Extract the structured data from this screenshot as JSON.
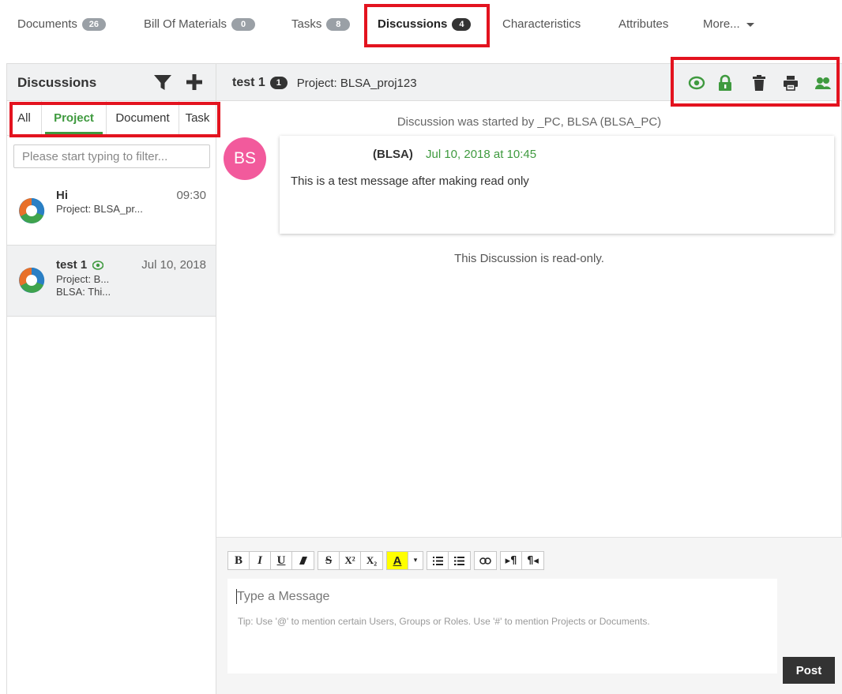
{
  "tabs": [
    {
      "label": "Documents",
      "count": "26"
    },
    {
      "label": "Bill Of Materials",
      "count": "0"
    },
    {
      "label": "Tasks",
      "count": "8"
    },
    {
      "label": "Discussions",
      "count": "4"
    },
    {
      "label": "Characteristics"
    },
    {
      "label": "Attributes"
    },
    {
      "label": "More..."
    }
  ],
  "active_tab": "Discussions",
  "sidebar": {
    "title": "Discussions",
    "filter_tabs": [
      "All",
      "Project",
      "Document",
      "Task"
    ],
    "active_filter": "Project",
    "filter_placeholder": "Please start typing to filter...",
    "items": [
      {
        "title": "Hi",
        "time": "09:30",
        "line1": "Project: BLSA_pr...",
        "line2": ""
      },
      {
        "title": "test 1",
        "time": "Jul 10, 2018",
        "line1": "Project: B...",
        "line2": "BLSA: Thi...",
        "watched": true,
        "selected": true
      }
    ]
  },
  "discussion": {
    "title": "test 1",
    "count": "1",
    "project": "Project: BLSA_proj123",
    "header_icons": [
      "eye-icon",
      "lock-icon",
      "trash-icon",
      "print-icon",
      "participants-icon"
    ],
    "started_text": "Discussion was started by _PC, BLSA (BLSA_PC)",
    "message": {
      "avatar": "BS",
      "author": "(BLSA)",
      "date": "Jul 10, 2018 at 10:45",
      "body": "This is a test message after making read only"
    },
    "readonly_text": "This Discussion is read-only."
  },
  "composer": {
    "toolbar": [
      "B",
      "I",
      "U",
      "eraser",
      "S",
      "X²",
      "X₂",
      "A",
      "▾",
      "bullet-list",
      "numbered-list",
      "link",
      "ltr",
      "rtl"
    ],
    "placeholder": "Type a Message",
    "tip": "Tip: Use '@' to mention certain Users, Groups or Roles. Use '#' to mention Projects or Documents.",
    "post_label": "Post"
  },
  "colors": {
    "accent_green": "#3f9a3f",
    "highlight_red": "#e3131f",
    "avatar_pink": "#f25a9c",
    "dark": "#333333"
  }
}
